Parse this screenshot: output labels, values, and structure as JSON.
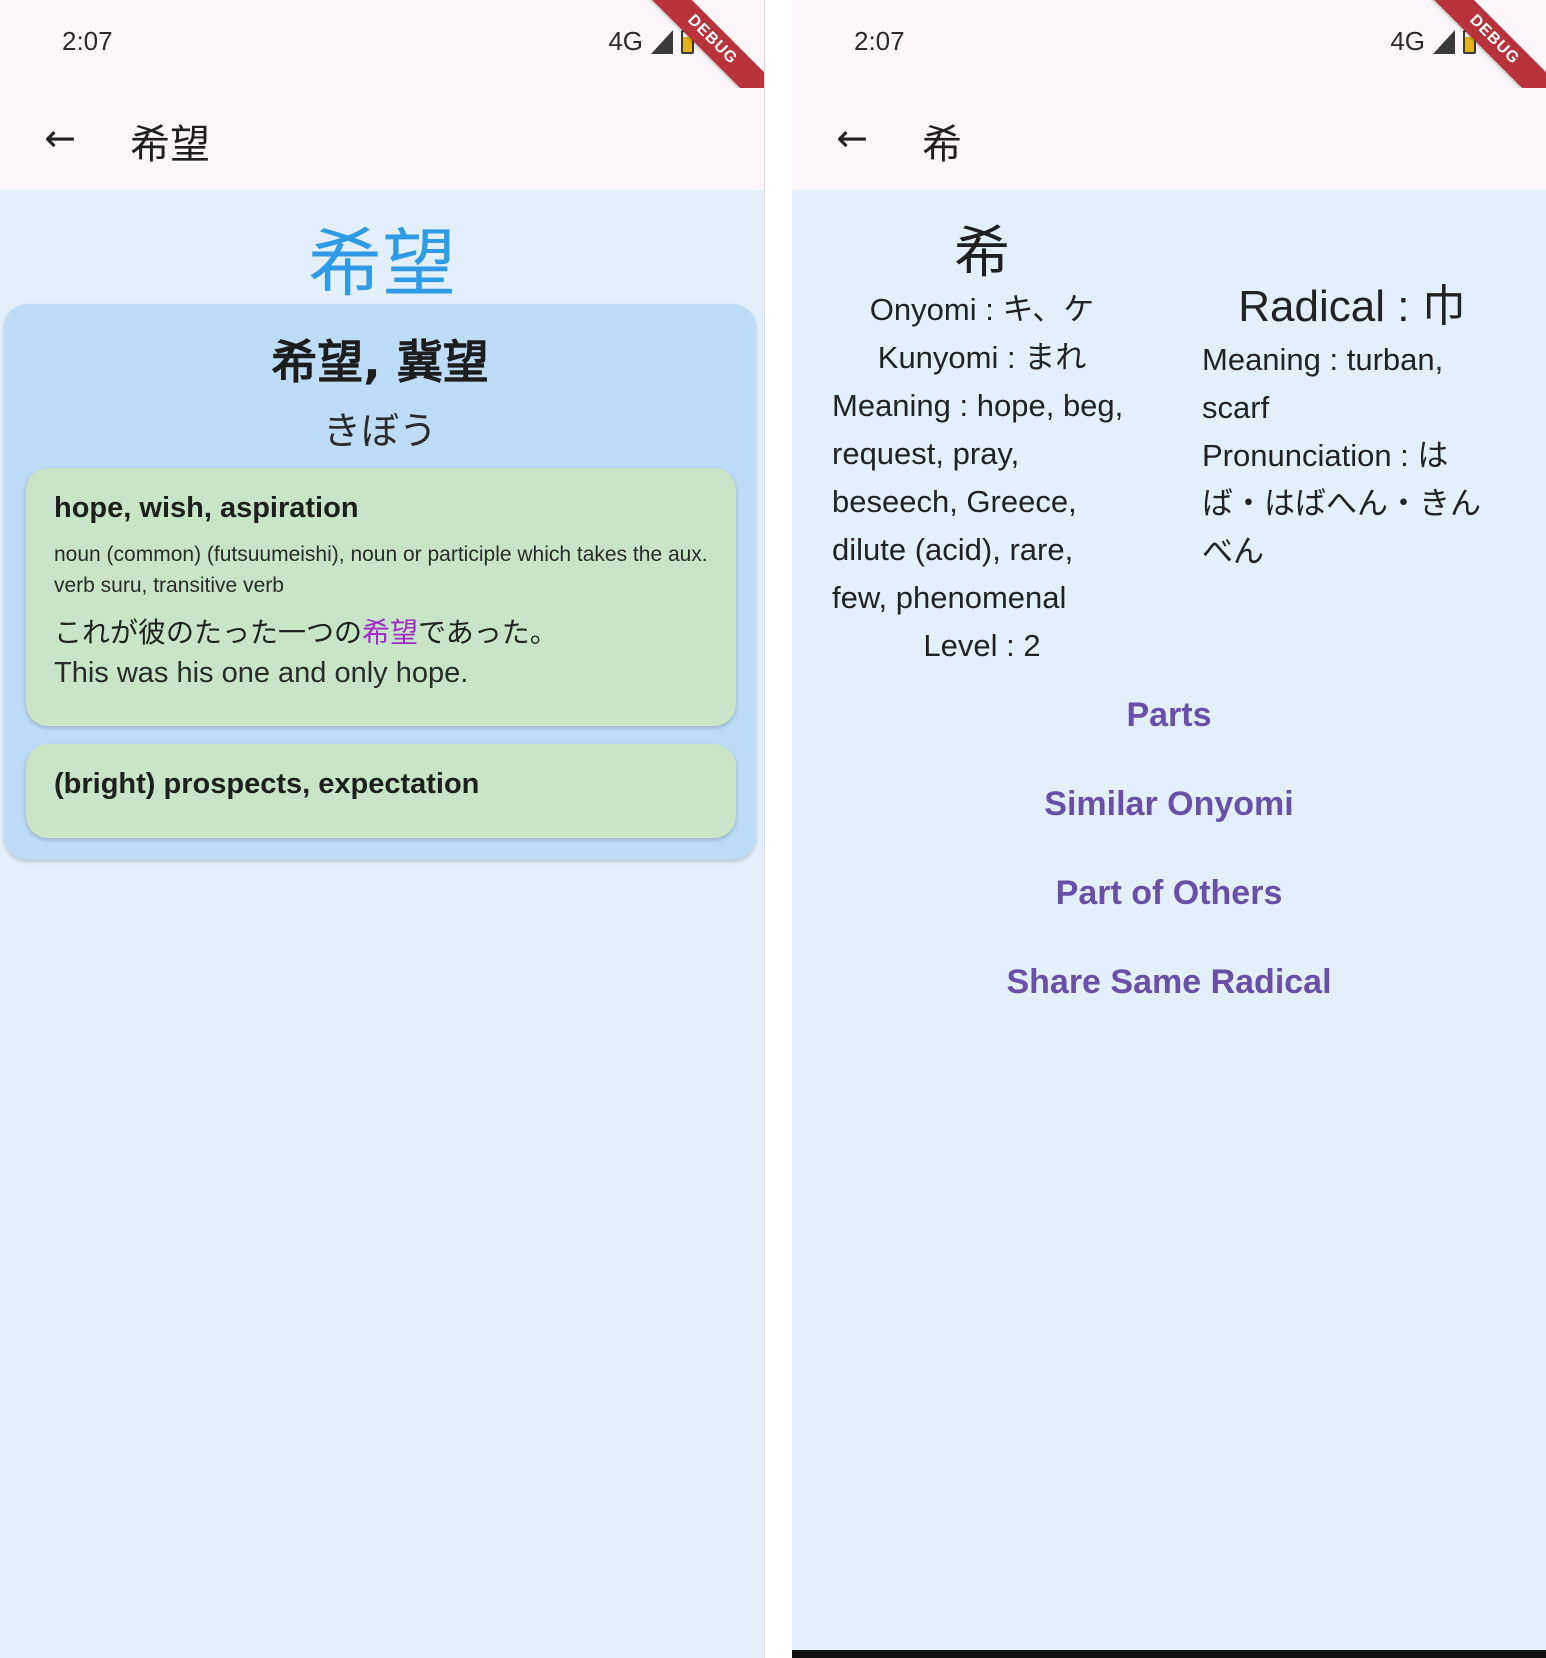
{
  "left": {
    "status": {
      "time": "2:07",
      "network": "4G",
      "debug_label": "DEBUG"
    },
    "app_bar": {
      "title": "希望"
    },
    "word": "希望",
    "entry": {
      "forms": "希望, 冀望",
      "reading": "きぼう",
      "senses": [
        {
          "gloss": "hope, wish, aspiration",
          "pos": "noun (common) (futsuumeishi), noun or participle which takes the aux. verb suru, transitive verb",
          "example_jp_before": "これが彼のたった一つの",
          "example_jp_highlight": "希望",
          "example_jp_after": "であった。",
          "example_en": "This was his one and only hope."
        },
        {
          "gloss": "(bright) prospects, expectation"
        }
      ]
    }
  },
  "right": {
    "status": {
      "time": "2:07",
      "network": "4G",
      "debug_label": "DEBUG"
    },
    "app_bar": {
      "title": "希"
    },
    "kanji": {
      "character": "希",
      "onyomi": "Onyomi : キ、ケ",
      "kunyomi": "Kunyomi : まれ",
      "meaning": "Meaning : hope, beg, request, pray, beseech, Greece, dilute (acid), rare, few, phenomenal",
      "level": "Level : 2"
    },
    "radical": {
      "title": "Radical : 巾",
      "meaning": "Meaning : turban, scarf",
      "pronunciation": "Pronunciation : はば・はばへん・きんべん"
    },
    "links": {
      "parts": "Parts",
      "similar_onyomi": "Similar Onyomi",
      "part_of_others": "Part of Others",
      "share_same_radical": "Share Same Radical"
    }
  },
  "colors": {
    "background": "#e3f0fb",
    "appbar": "#fdf7fc",
    "word_accent": "#2f9be6",
    "entry_card": "#bcdcf7",
    "sense_card": "#c8e5c8",
    "highlight": "#a02cc7",
    "link": "#6a4fa8",
    "debug_ribbon": "#b8323a"
  },
  "icons": {
    "back": "arrow-left-icon",
    "signal": "cell-signal-icon",
    "battery": "battery-charging-icon"
  }
}
